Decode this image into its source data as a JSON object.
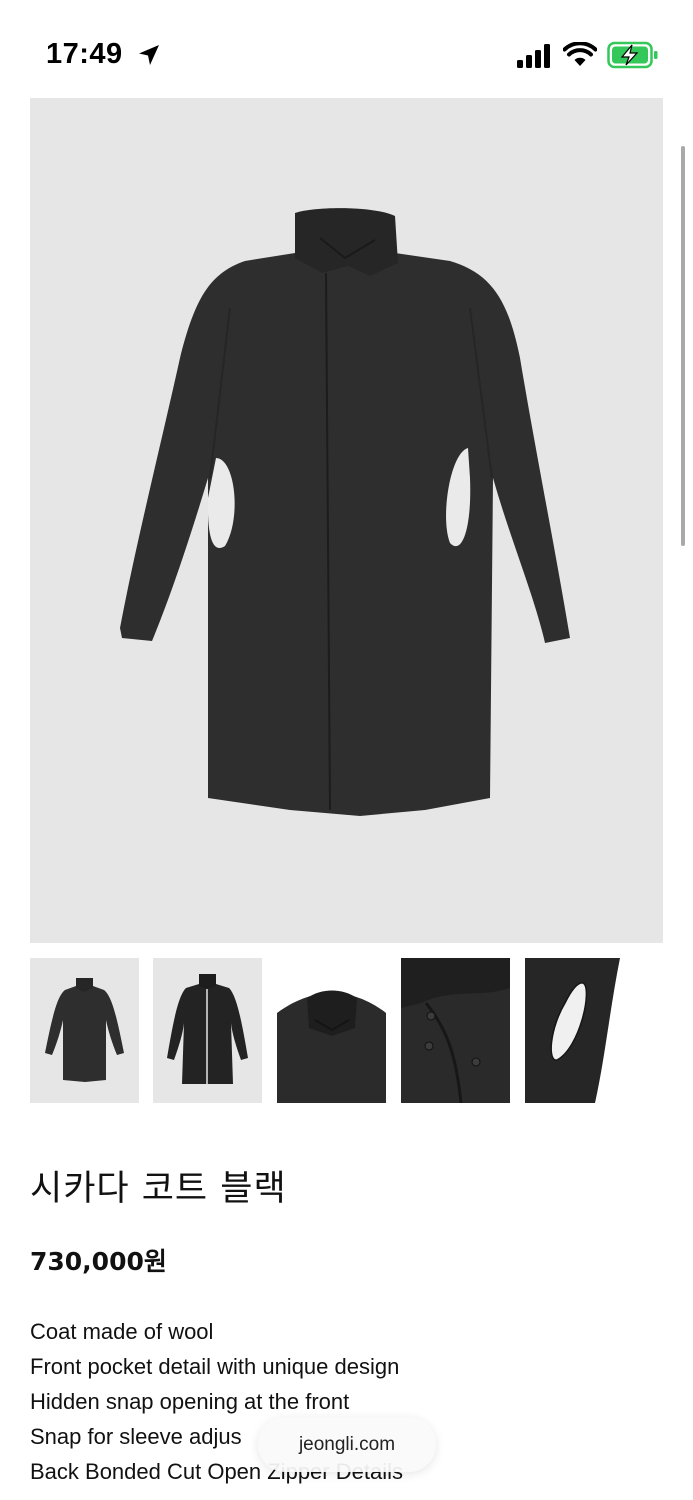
{
  "status_bar": {
    "time": "17:49",
    "icons": [
      "location-arrow-icon",
      "cellular-signal-icon",
      "wifi-icon",
      "battery-charging-icon"
    ],
    "battery_color": "#34c759"
  },
  "gallery": {
    "main_image": "black long coat front view",
    "thumbnails": [
      {
        "label": "coat front view"
      },
      {
        "label": "coat front open zipper view"
      },
      {
        "label": "collar close-up"
      },
      {
        "label": "snap close-up"
      },
      {
        "label": "pocket close-up"
      }
    ]
  },
  "product": {
    "title": "시카다 코트 블랙",
    "price": "730,000원",
    "description": [
      "Coat made of wool",
      "Front pocket detail with unique design",
      "Hidden snap opening at the front",
      "Snap for sleeve adjus",
      "Back Bonded Cut Open Zipper Details"
    ]
  },
  "browser": {
    "url": "jeongli.com"
  },
  "colors": {
    "image_background": "#e6e6e6",
    "coat": "#2f2f2f"
  }
}
